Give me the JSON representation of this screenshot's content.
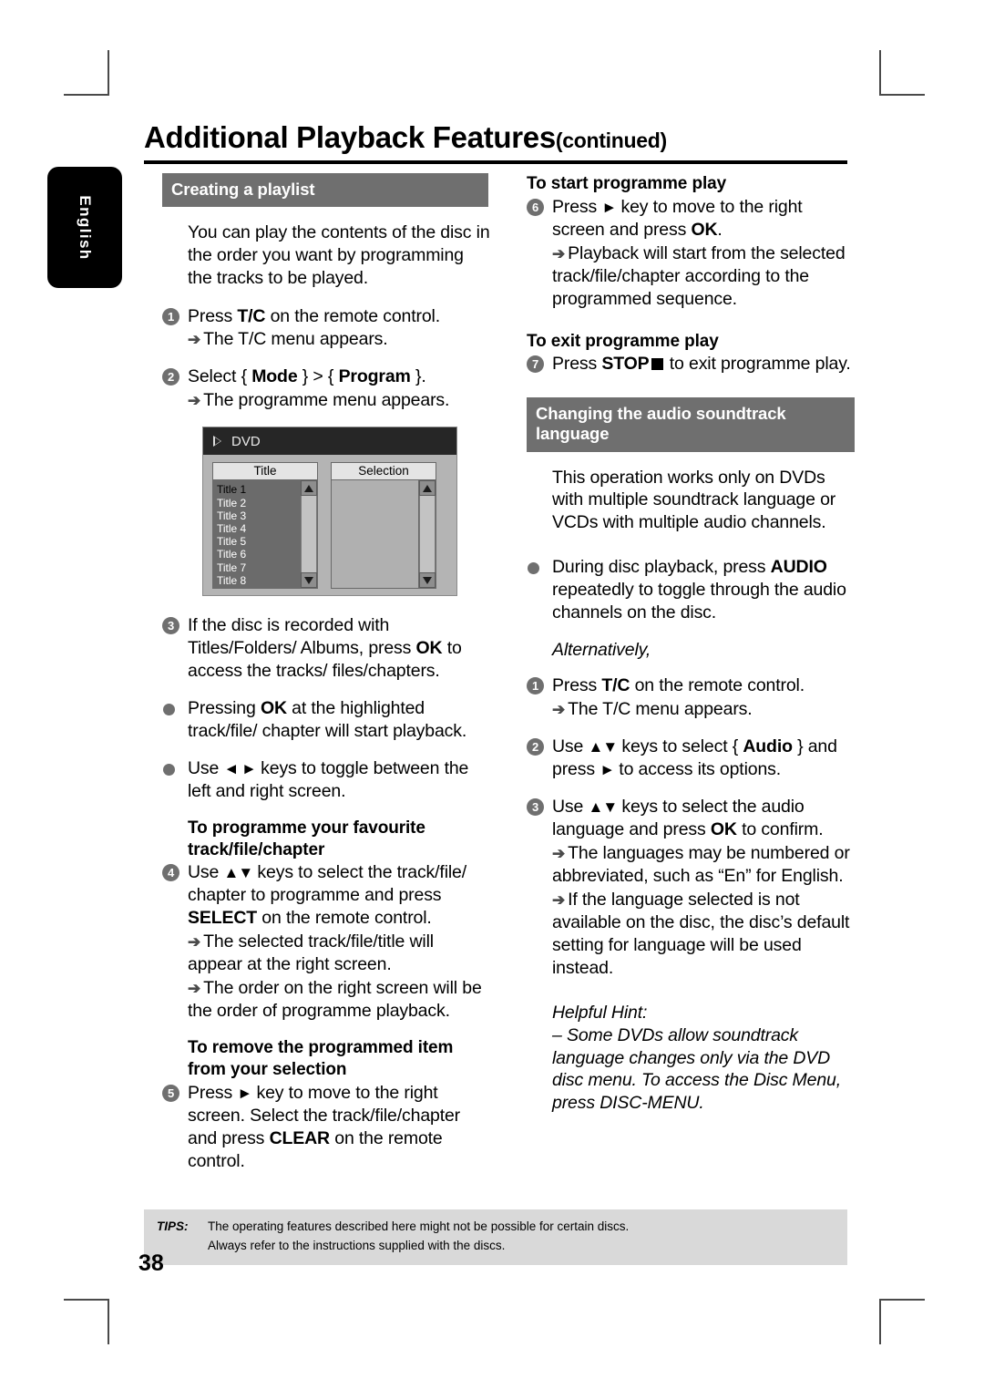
{
  "page": {
    "language_tab": "English",
    "title": "Additional Playback Features",
    "title_suffix": "(continued)",
    "page_number": "38"
  },
  "left_column": {
    "section_heading": "Creating a playlist",
    "intro": "You can play the contents of the disc in the order you want by programming the tracks to be played.",
    "step1": {
      "num": "1",
      "text_a": "Press ",
      "bold": "T/C",
      "text_b": " on the remote control.",
      "result": "The T/C menu appears."
    },
    "step2": {
      "num": "2",
      "text_a": "Select { ",
      "bold_a": "Mode",
      "text_b": " } > { ",
      "bold_b": "Program",
      "text_c": " }.",
      "result": "The programme menu appears."
    },
    "osd": {
      "title": "DVD",
      "play_icon": "play-triangle-icon",
      "left_panel_header": "Title",
      "right_panel_header": "Selection",
      "titles": [
        "Title 1",
        "Title 2",
        "Title 3",
        "Title 4",
        "Title 5",
        "Title 6",
        "Title 7",
        "Title 8"
      ],
      "selected_title": "Title 1",
      "selection_items": []
    },
    "step3": {
      "num": "3",
      "text_a": "If the disc is recorded with Titles/Folders/ Albums, press ",
      "bold": "OK",
      "text_b": " to access the tracks/ files/chapters."
    },
    "bullet1": {
      "text_a": "Pressing ",
      "bold": "OK",
      "text_b": " at the highlighted track/file/ chapter will start playback."
    },
    "bullet2": {
      "text_a": "Use ",
      "keys": "◄ ►",
      "text_b": " keys to toggle between the left and right screen."
    },
    "subhead_programme": "To programme your favourite track/file/chapter",
    "step4": {
      "num": "4",
      "text_a": "Use ",
      "keys": "▲▼",
      "text_b": " keys to select the track/file/ chapter to programme and press ",
      "bold": "SELECT",
      "text_c": " on the remote control.",
      "result1": "The selected track/file/title will appear at the right screen.",
      "result2": "The order on the right screen will be the order of programme playback."
    },
    "subhead_remove": "To remove the programmed item from your selection",
    "step5": {
      "num": "5",
      "text_a": "Press ",
      "keys": "►",
      "text_b": " key to move to the right screen. Select the track/file/chapter and press ",
      "bold": "CLEAR",
      "text_c": " on the remote control."
    }
  },
  "right_column": {
    "subhead_start": "To start programme play",
    "step6": {
      "num": "6",
      "text_a": "Press ",
      "keys": "►",
      "text_b": " key to move to the right screen and press ",
      "bold": "OK",
      "text_c": ".",
      "result": "Playback will start from the selected track/file/chapter according to the programmed sequence."
    },
    "subhead_exit": "To exit programme play",
    "step7": {
      "num": "7",
      "text_a": "Press ",
      "bold": "STOP",
      "stop_icon": "stop-square-icon",
      "text_b": " to exit programme play."
    },
    "section_heading": "Changing the audio soundtrack language",
    "intro": "This operation works only on DVDs with multiple soundtrack language or VCDs with multiple audio channels.",
    "bullet_audio": {
      "text_a": "During disc playback, press ",
      "bold": "AUDIO",
      "text_b": " repeatedly to toggle through the audio channels on the disc."
    },
    "alternatively": "Alternatively,",
    "alt_step1": {
      "num": "1",
      "text_a": "Press ",
      "bold": "T/C",
      "text_b": " on the remote control.",
      "result": "The T/C menu appears."
    },
    "alt_step2": {
      "num": "2",
      "text_a": "Use ",
      "keys": "▲▼",
      "text_b": " keys to select { ",
      "bold": "Audio",
      "text_c": " } and press ",
      "keys2": "►",
      "text_d": " to access its options."
    },
    "alt_step3": {
      "num": "3",
      "text_a": "Use ",
      "keys": "▲▼",
      "text_b": " keys to select the audio language and press ",
      "bold": "OK",
      "text_c": " to confirm.",
      "result1": "The languages may be numbered or abbreviated, such as “En” for English.",
      "result2": "If the language selected is not available on the disc, the disc’s default setting for language will be used instead."
    },
    "hint_label": "Helpful Hint:",
    "hint_text": "– Some DVDs allow soundtrack language changes only via the DVD disc menu. To access the Disc Menu, press DISC-MENU."
  },
  "tips": {
    "label": "TIPS:",
    "line1": "The operating features described here might not be possible for certain discs.",
    "line2": "Always refer to the instructions supplied with the discs."
  },
  "colors": {
    "section_bar": "#6f6f6f",
    "tips_bg": "#d9d9d9",
    "tab_bg": "#000000"
  }
}
